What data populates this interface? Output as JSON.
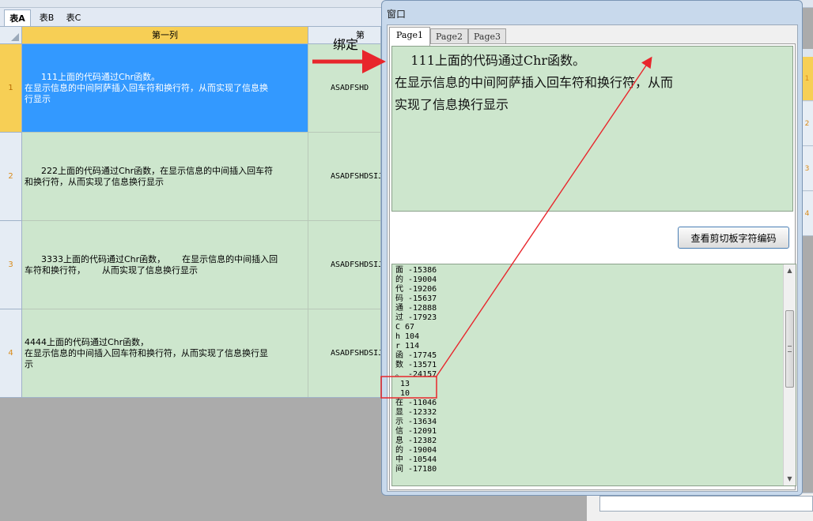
{
  "sheet": {
    "tabs": [
      {
        "label": "表A",
        "active": true
      },
      {
        "label": "表B",
        "active": false
      },
      {
        "label": "表C",
        "active": false
      }
    ],
    "columns": [
      "第一列",
      "第"
    ],
    "rows": [
      {
        "num": "1",
        "text": "      111上面的代码通过Chr函数。\n在显示信息的中间阿萨插入回车符和换行符，从而实现了信息换\n行显示",
        "value": "ASADFSHD",
        "selected": true
      },
      {
        "num": "2",
        "text": "      222上面的代码通过Chr函数，在显示信息的中间插入回车符\n和换行符，从而实现了信息换行显示",
        "value": "ASADFSHDSIJ",
        "selected": false
      },
      {
        "num": "3",
        "text": "      3333上面的代码通过Chr函数，      在显示信息的中间插入回\n车符和换行符，      从而实现了信息换行显示",
        "value": "ASADFSHDSIJ",
        "selected": false
      },
      {
        "num": "4",
        "text": "4444上面的代码通过Chr函数，\n在显示信息的中间插入回车符和换行符，从而实现了信息换行显\n示",
        "value": "ASADFSHDSIJ",
        "selected": false
      }
    ]
  },
  "annotation": {
    "bind_label": "绑定"
  },
  "right_grid": {
    "rows": [
      "1",
      "2",
      "3",
      "4"
    ]
  },
  "window": {
    "title": "窗口",
    "tabs": [
      "Page1",
      "Page2",
      "Page3"
    ],
    "display_text": "    111上面的代码通过Chr函数。\n在显示信息的中间阿萨插入回车符和换行符，从而\n实现了信息换行显示",
    "button_label": "查看剪切板字符编码",
    "code_lines": [
      "面 -15386",
      "的 -19004",
      "代 -19206",
      "码 -15637",
      "通 -12888",
      "过 -17923",
      "C 67",
      "h 104",
      "r 114",
      "函 -17745",
      "数 -13571",
      "。 -24157",
      " 13",
      " 10",
      "在 -11046",
      "显 -12332",
      "示 -13634",
      "信 -12091",
      "息 -12382",
      "的 -19004",
      "中 -10544",
      "间 -17180"
    ]
  },
  "colors": {
    "accent_red": "#e8262c",
    "cell_green": "#cde6cd",
    "selection_blue": "#3399ff",
    "header_gold": "#f7cf55"
  }
}
